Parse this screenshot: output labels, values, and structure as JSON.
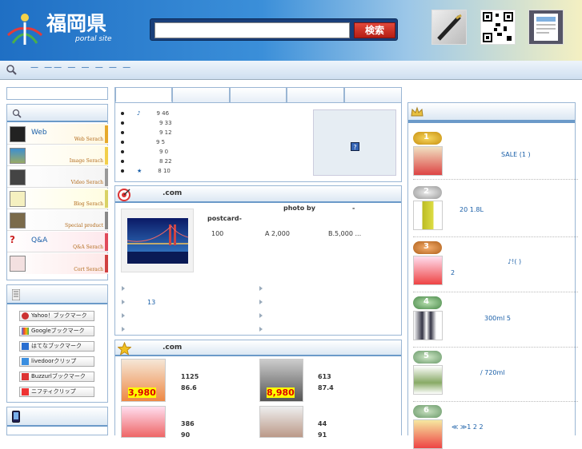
{
  "header": {
    "logo_title": "福岡県",
    "logo_sub": "portal site",
    "search_button": "検索",
    "search_placeholder": ""
  },
  "subnav": {
    "text": "— —— — — — — —"
  },
  "side": {
    "search_rows": [
      {
        "label": "Web",
        "tag": "Web Serach"
      },
      {
        "label": "",
        "tag": "Image Serach"
      },
      {
        "label": "",
        "tag": "Video Serach"
      },
      {
        "label": "",
        "tag": "Blog Serach"
      },
      {
        "label": "",
        "tag": "Special product"
      },
      {
        "label": "Q&A",
        "tag": "Q&A Serach"
      },
      {
        "label": "",
        "tag": "Cort Serach"
      }
    ],
    "bookmarks": [
      "Yahoo！ブックマーク",
      "Googleブックマーク",
      "はてなブックマーク",
      "livedoorクリップ",
      "Buzzurlブックマーク",
      "ニフティクリップ"
    ]
  },
  "news": {
    "items": [
      {
        "mark": "♪",
        "date": "9 46"
      },
      {
        "mark": "",
        "date": "9 33"
      },
      {
        "mark": "",
        "date": "9 12"
      },
      {
        "mark": "",
        "date": "9 5"
      },
      {
        "mark": "",
        "date": "9 0"
      },
      {
        "mark": "",
        "date": "8 22"
      },
      {
        "mark": "★",
        "date": "8 10"
      }
    ],
    "help_icon": "?"
  },
  "postcard": {
    "title": ".com",
    "photo_by": "photo by",
    "dash": "-",
    "brand": "postcard-",
    "p1": "100",
    "p2": "A   2,000",
    "p3": "B.5,000  ...",
    "links_left": [
      "",
      "13",
      "",
      ""
    ],
    "links_right": [
      "",
      "",
      "",
      ""
    ]
  },
  "shop": {
    "title": ".com",
    "items": [
      {
        "n1": "1125",
        "n2": "86.6",
        "price": "3,980"
      },
      {
        "n1": "613",
        "n2": "87.4",
        "price": "8,980"
      },
      {
        "n1": "386",
        "n2": "90"
      },
      {
        "n1": "44",
        "n2": "91"
      }
    ]
  },
  "ranking": {
    "items": [
      {
        "num": "1",
        "text": "SALE      (1        )"
      },
      {
        "num": "2",
        "text": "20     1.8L"
      },
      {
        "num": "3",
        "text": "♪!(           )",
        "text2": "2"
      },
      {
        "num": "4",
        "text": "300ml 5"
      },
      {
        "num": "5",
        "text": "/    720ml"
      },
      {
        "num": "6",
        "text": "≪        ≫1  2                    2"
      }
    ]
  },
  "colors": {
    "accent": "#1f6fc4",
    "panel_border": "#9ab6d4"
  }
}
